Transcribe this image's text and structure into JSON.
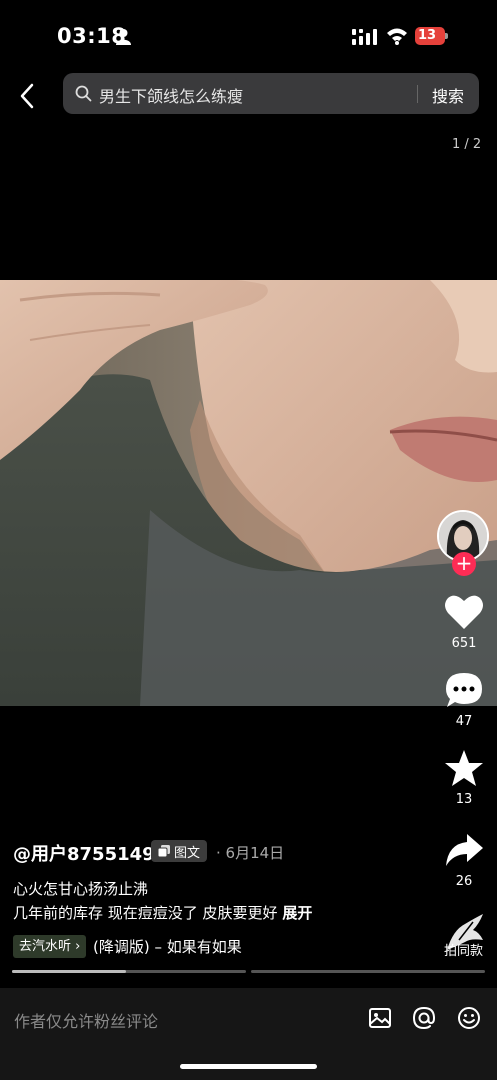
{
  "status": {
    "time": "03:18",
    "battery": "13"
  },
  "search": {
    "query": "男生下颌线怎么练瘦",
    "button": "搜索"
  },
  "page_indicator": "1 / 2",
  "actions": {
    "likes": "651",
    "comments": "47",
    "favorites": "13",
    "shares": "26",
    "same_style": "拍同款"
  },
  "post": {
    "author": "@用户8755149",
    "tag": "图文",
    "date": "· 6月14日",
    "caption_line1": "心火怎甘心扬汤止沸",
    "caption_line2": "几年前的库存  现在痘痘没了 皮肤要更好",
    "expand": "展开",
    "music_tag": "去汽水听 ›",
    "music_title": "(降调版) – 如果有如果"
  },
  "comment_bar": {
    "placeholder": "作者仅允许粉丝评论"
  },
  "colors": {
    "accent": "#fe2c55",
    "background": "#000000",
    "search_bg": "#3a3a3c"
  },
  "progress": {
    "segment1_fraction": 0.5
  }
}
